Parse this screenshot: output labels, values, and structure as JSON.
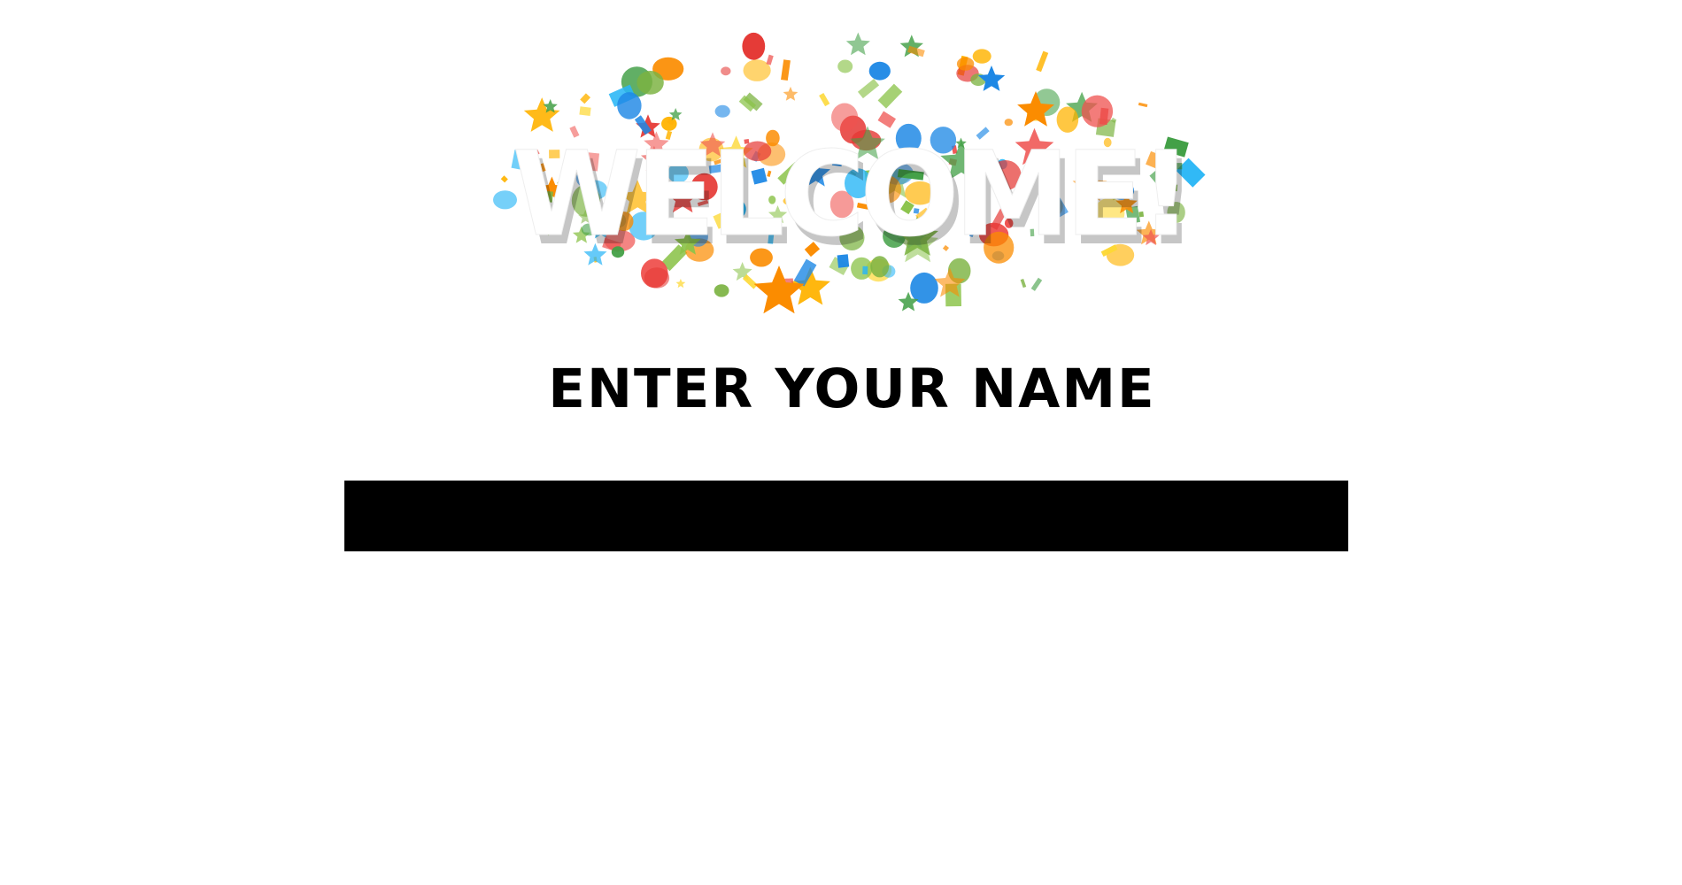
{
  "banner": {
    "text": "WELCOME!",
    "description": "welcome-banner-with-confetti"
  },
  "form": {
    "prompt": "ENTER YOUR NAME",
    "name_value": "",
    "name_placeholder": ""
  },
  "colors": {
    "background": "#ffffff",
    "prompt_text": "#000000",
    "input_background": "#000000",
    "confetti": [
      "#e53935",
      "#1e88e5",
      "#fb8c00",
      "#fdd835",
      "#43a047",
      "#8bc34a",
      "#29b6f6",
      "#ef5350",
      "#ffb300",
      "#7cb342"
    ]
  }
}
